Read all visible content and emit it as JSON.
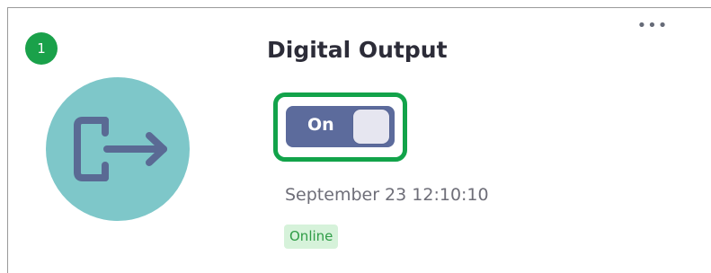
{
  "card": {
    "step_number": "1",
    "title": "Digital Output",
    "menu_icon": "ellipsis-horizontal-icon",
    "device_icon": "exit-arrow-icon",
    "toggle": {
      "label": "On",
      "state": "on"
    },
    "timestamp": "September 23 12:10:10",
    "status": "Online"
  },
  "colors": {
    "badge": "#1aa14a",
    "highlight": "#12a34a",
    "avatar": "#7ec7c9",
    "toggle_on": "#5c6b9c",
    "status_bg": "#d6f2da",
    "status_text": "#2f9c46"
  }
}
